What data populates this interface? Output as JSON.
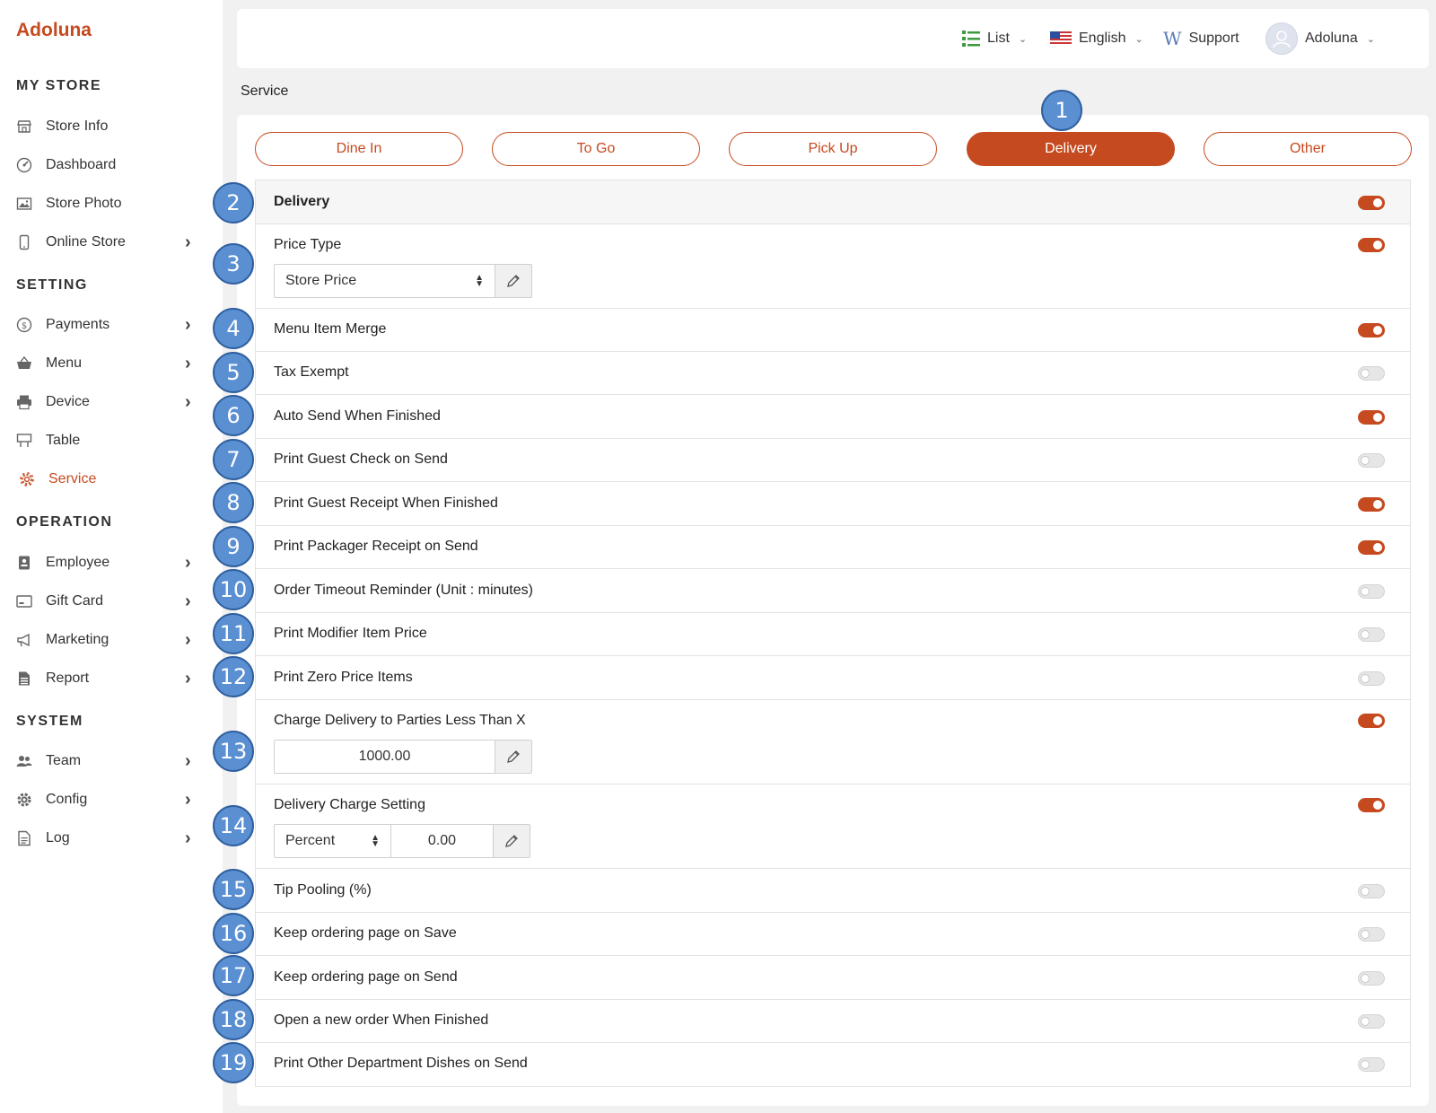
{
  "brand": "Adoluna",
  "sidebar": {
    "sections": [
      {
        "title": "MY STORE",
        "items": [
          {
            "label": "Store Info",
            "icon": "store-icon",
            "chevron": false
          },
          {
            "label": "Dashboard",
            "icon": "dashboard-icon",
            "chevron": false
          },
          {
            "label": "Store Photo",
            "icon": "photo-icon",
            "chevron": false
          },
          {
            "label": "Online Store",
            "icon": "mobile-icon",
            "chevron": true
          }
        ]
      },
      {
        "title": "SETTING",
        "items": [
          {
            "label": "Payments",
            "icon": "dollar-icon",
            "chevron": true
          },
          {
            "label": "Menu",
            "icon": "basket-icon",
            "chevron": true
          },
          {
            "label": "Device",
            "icon": "printer-icon",
            "chevron": true
          },
          {
            "label": "Table",
            "icon": "table-icon",
            "chevron": false
          },
          {
            "label": "Service",
            "icon": "gear-icon",
            "chevron": false,
            "active": true
          }
        ]
      },
      {
        "title": "OPERATION",
        "items": [
          {
            "label": "Employee",
            "icon": "badge-icon",
            "chevron": true
          },
          {
            "label": "Gift Card",
            "icon": "gift-card-icon",
            "chevron": true
          },
          {
            "label": "Marketing",
            "icon": "megaphone-icon",
            "chevron": true
          },
          {
            "label": "Report",
            "icon": "report-icon",
            "chevron": true
          }
        ]
      },
      {
        "title": "SYSTEM",
        "items": [
          {
            "label": "Team",
            "icon": "team-icon",
            "chevron": true
          },
          {
            "label": "Config",
            "icon": "cog-icon",
            "chevron": true
          },
          {
            "label": "Log",
            "icon": "log-icon",
            "chevron": true
          }
        ]
      }
    ]
  },
  "header": {
    "list_label": "List",
    "language_label": "English",
    "support_label": "Support",
    "user_label": "Adoluna"
  },
  "page_title": "Service",
  "tabs": [
    {
      "label": "Dine In",
      "active": false
    },
    {
      "label": "To Go",
      "active": false
    },
    {
      "label": "Pick Up",
      "active": false
    },
    {
      "label": "Delivery",
      "active": true
    },
    {
      "label": "Other",
      "active": false
    }
  ],
  "settings": [
    {
      "label": "Delivery",
      "on": true,
      "header": true
    },
    {
      "label": "Price Type",
      "on": true,
      "control": {
        "type": "select",
        "value": "Store Price"
      }
    },
    {
      "label": "Menu Item Merge",
      "on": true
    },
    {
      "label": "Tax Exempt",
      "on": false
    },
    {
      "label": "Auto Send When Finished",
      "on": true
    },
    {
      "label": "Print Guest Check on Send",
      "on": false
    },
    {
      "label": "Print Guest Receipt When Finished",
      "on": true
    },
    {
      "label": "Print Packager Receipt on Send",
      "on": true
    },
    {
      "label": "Order Timeout Reminder (Unit : minutes)",
      "on": false
    },
    {
      "label": "Print Modifier Item Price",
      "on": false
    },
    {
      "label": "Print Zero Price Items",
      "on": false
    },
    {
      "label": "Charge Delivery to Parties Less Than X",
      "on": true,
      "control": {
        "type": "value",
        "value": "1000.00"
      }
    },
    {
      "label": "Delivery Charge Setting",
      "on": true,
      "control": {
        "type": "select-value",
        "select": "Percent",
        "value": "0.00"
      }
    },
    {
      "label": "Tip Pooling (%)",
      "on": false
    },
    {
      "label": "Keep ordering page on Save",
      "on": false
    },
    {
      "label": "Keep ordering page on Send",
      "on": false
    },
    {
      "label": "Open a new order When Finished",
      "on": false
    },
    {
      "label": "Print Other Department Dishes on Send",
      "on": false
    }
  ],
  "callouts": [
    "1",
    "2",
    "3",
    "4",
    "5",
    "6",
    "7",
    "8",
    "9",
    "10",
    "11",
    "12",
    "13",
    "14",
    "15",
    "16",
    "17",
    "18",
    "19"
  ],
  "colors": {
    "accent": "#c64a1f",
    "callout": "#5a8fd2"
  }
}
